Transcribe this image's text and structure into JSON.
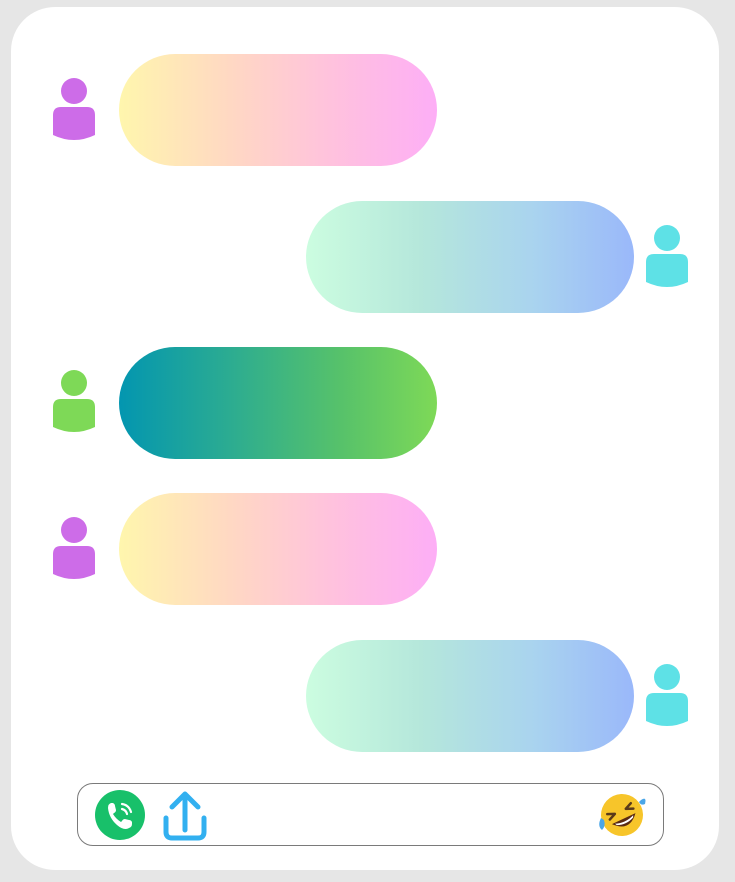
{
  "colors": {
    "page_background": "#e6e6e6",
    "card_background": "#ffffff",
    "avatar_purple": "#cd6ce8",
    "avatar_cyan": "#5ee1e6",
    "avatar_green": "#7ed957",
    "bubble_peach": [
      "#fff6ad",
      "#fdaef6"
    ],
    "bubble_mint": [
      "#ccfde0",
      "#9ab8fa"
    ],
    "bubble_teal": [
      "#0396b0",
      "#7ed957"
    ],
    "call_button": "#18c06a",
    "upload_icon": "#32b0f0"
  },
  "messages": [
    {
      "side": "left",
      "avatar": "user-icon",
      "avatar_color": "purple",
      "bubble_style": "peach",
      "text": ""
    },
    {
      "side": "right",
      "avatar": "user-icon",
      "avatar_color": "cyan",
      "bubble_style": "mint",
      "text": ""
    },
    {
      "side": "left",
      "avatar": "user-icon",
      "avatar_color": "green",
      "bubble_style": "teal",
      "text": ""
    },
    {
      "side": "left",
      "avatar": "user-icon",
      "avatar_color": "purple",
      "bubble_style": "peach",
      "text": ""
    },
    {
      "side": "right",
      "avatar": "user-icon",
      "avatar_color": "cyan",
      "bubble_style": "mint",
      "text": ""
    }
  ],
  "composer": {
    "icons": [
      "phone-call-icon",
      "upload-icon",
      "rolling-laughing-emoji-icon"
    ],
    "input_value": ""
  }
}
